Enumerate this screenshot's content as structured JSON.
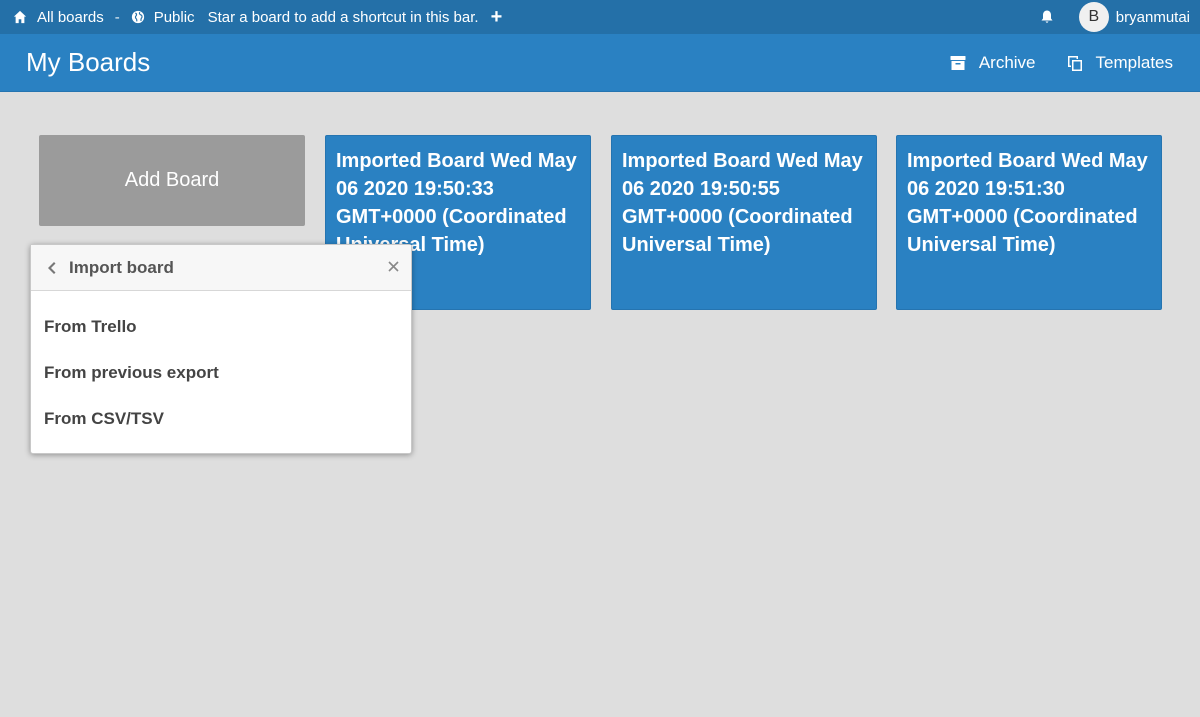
{
  "topbar": {
    "all_boards": "All boards",
    "separator": "-",
    "public": "Public",
    "shortcut_hint": "Star a board to add a shortcut in this bar.",
    "plus": "+",
    "avatar_initial": "B",
    "username": "bryanmutai"
  },
  "header": {
    "title": "My Boards",
    "archive_label": "Archive",
    "templates_label": "Templates"
  },
  "add_board": {
    "label": "Add Board"
  },
  "boards": [
    {
      "title": "Imported Board Wed May 06 2020 19:50:33 GMT+0000 (Coordinated Universal Time)"
    },
    {
      "title": "Imported Board Wed May 06 2020 19:50:55 GMT+0000 (Coordinated Universal Time)"
    },
    {
      "title": "Imported Board Wed May 06 2020 19:51:30 GMT+0000 (Coordinated Universal Time)"
    }
  ],
  "import_popup": {
    "title": "Import board",
    "items": [
      {
        "label": "From Trello"
      },
      {
        "label": "From previous export"
      },
      {
        "label": "From CSV/TSV"
      }
    ]
  },
  "colors": {
    "topbar_bg": "#2470a8",
    "header_bg": "#2a81c2",
    "board_bg": "#2a81c2",
    "add_board_bg": "#9b9b9b",
    "page_bg": "#dedede"
  }
}
